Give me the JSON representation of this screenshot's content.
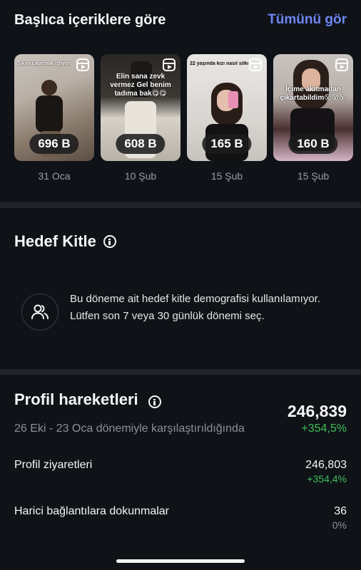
{
  "top_content": {
    "title": "Başlıca içeriklere göre",
    "see_all": "Tümünü gör",
    "items": [
      {
        "caption": "Sikini çıkarmak istiyor",
        "count": "696 B",
        "date": "31 Oca"
      },
      {
        "caption": "Elin sana zevk vermez Gel benim tadıma bak😋😋",
        "count": "608 B",
        "date": "10 Şub"
      },
      {
        "caption": "22 yaşında kızı nasıl silke",
        "count": "165 B",
        "date": "15 Şub"
      },
      {
        "caption": "İçime akıtmadan çıkartabildim😵😵😵",
        "count": "160 B",
        "date": "15 Şub"
      }
    ]
  },
  "audience": {
    "title": "Hedef Kitle",
    "message": "Bu döneme ait hedef kitle demografisi kullanılamıyor. Lütfen son 7 veya 30 günlük dönemi seç."
  },
  "profile": {
    "title": "Profil hareketleri",
    "total": "246,839",
    "comparison": "26 Eki - 23 Oca dönemiyle karşılaştırıldığında",
    "total_change": "+354,5%",
    "metrics": [
      {
        "label": "Profil ziyaretleri",
        "value": "246,803",
        "change": "+354,4%",
        "change_color": "#3fbf5a"
      },
      {
        "label": "Harici bağlantılara dokunmalar",
        "value": "36",
        "change": "0%",
        "change_color": "#8b9098"
      }
    ]
  }
}
